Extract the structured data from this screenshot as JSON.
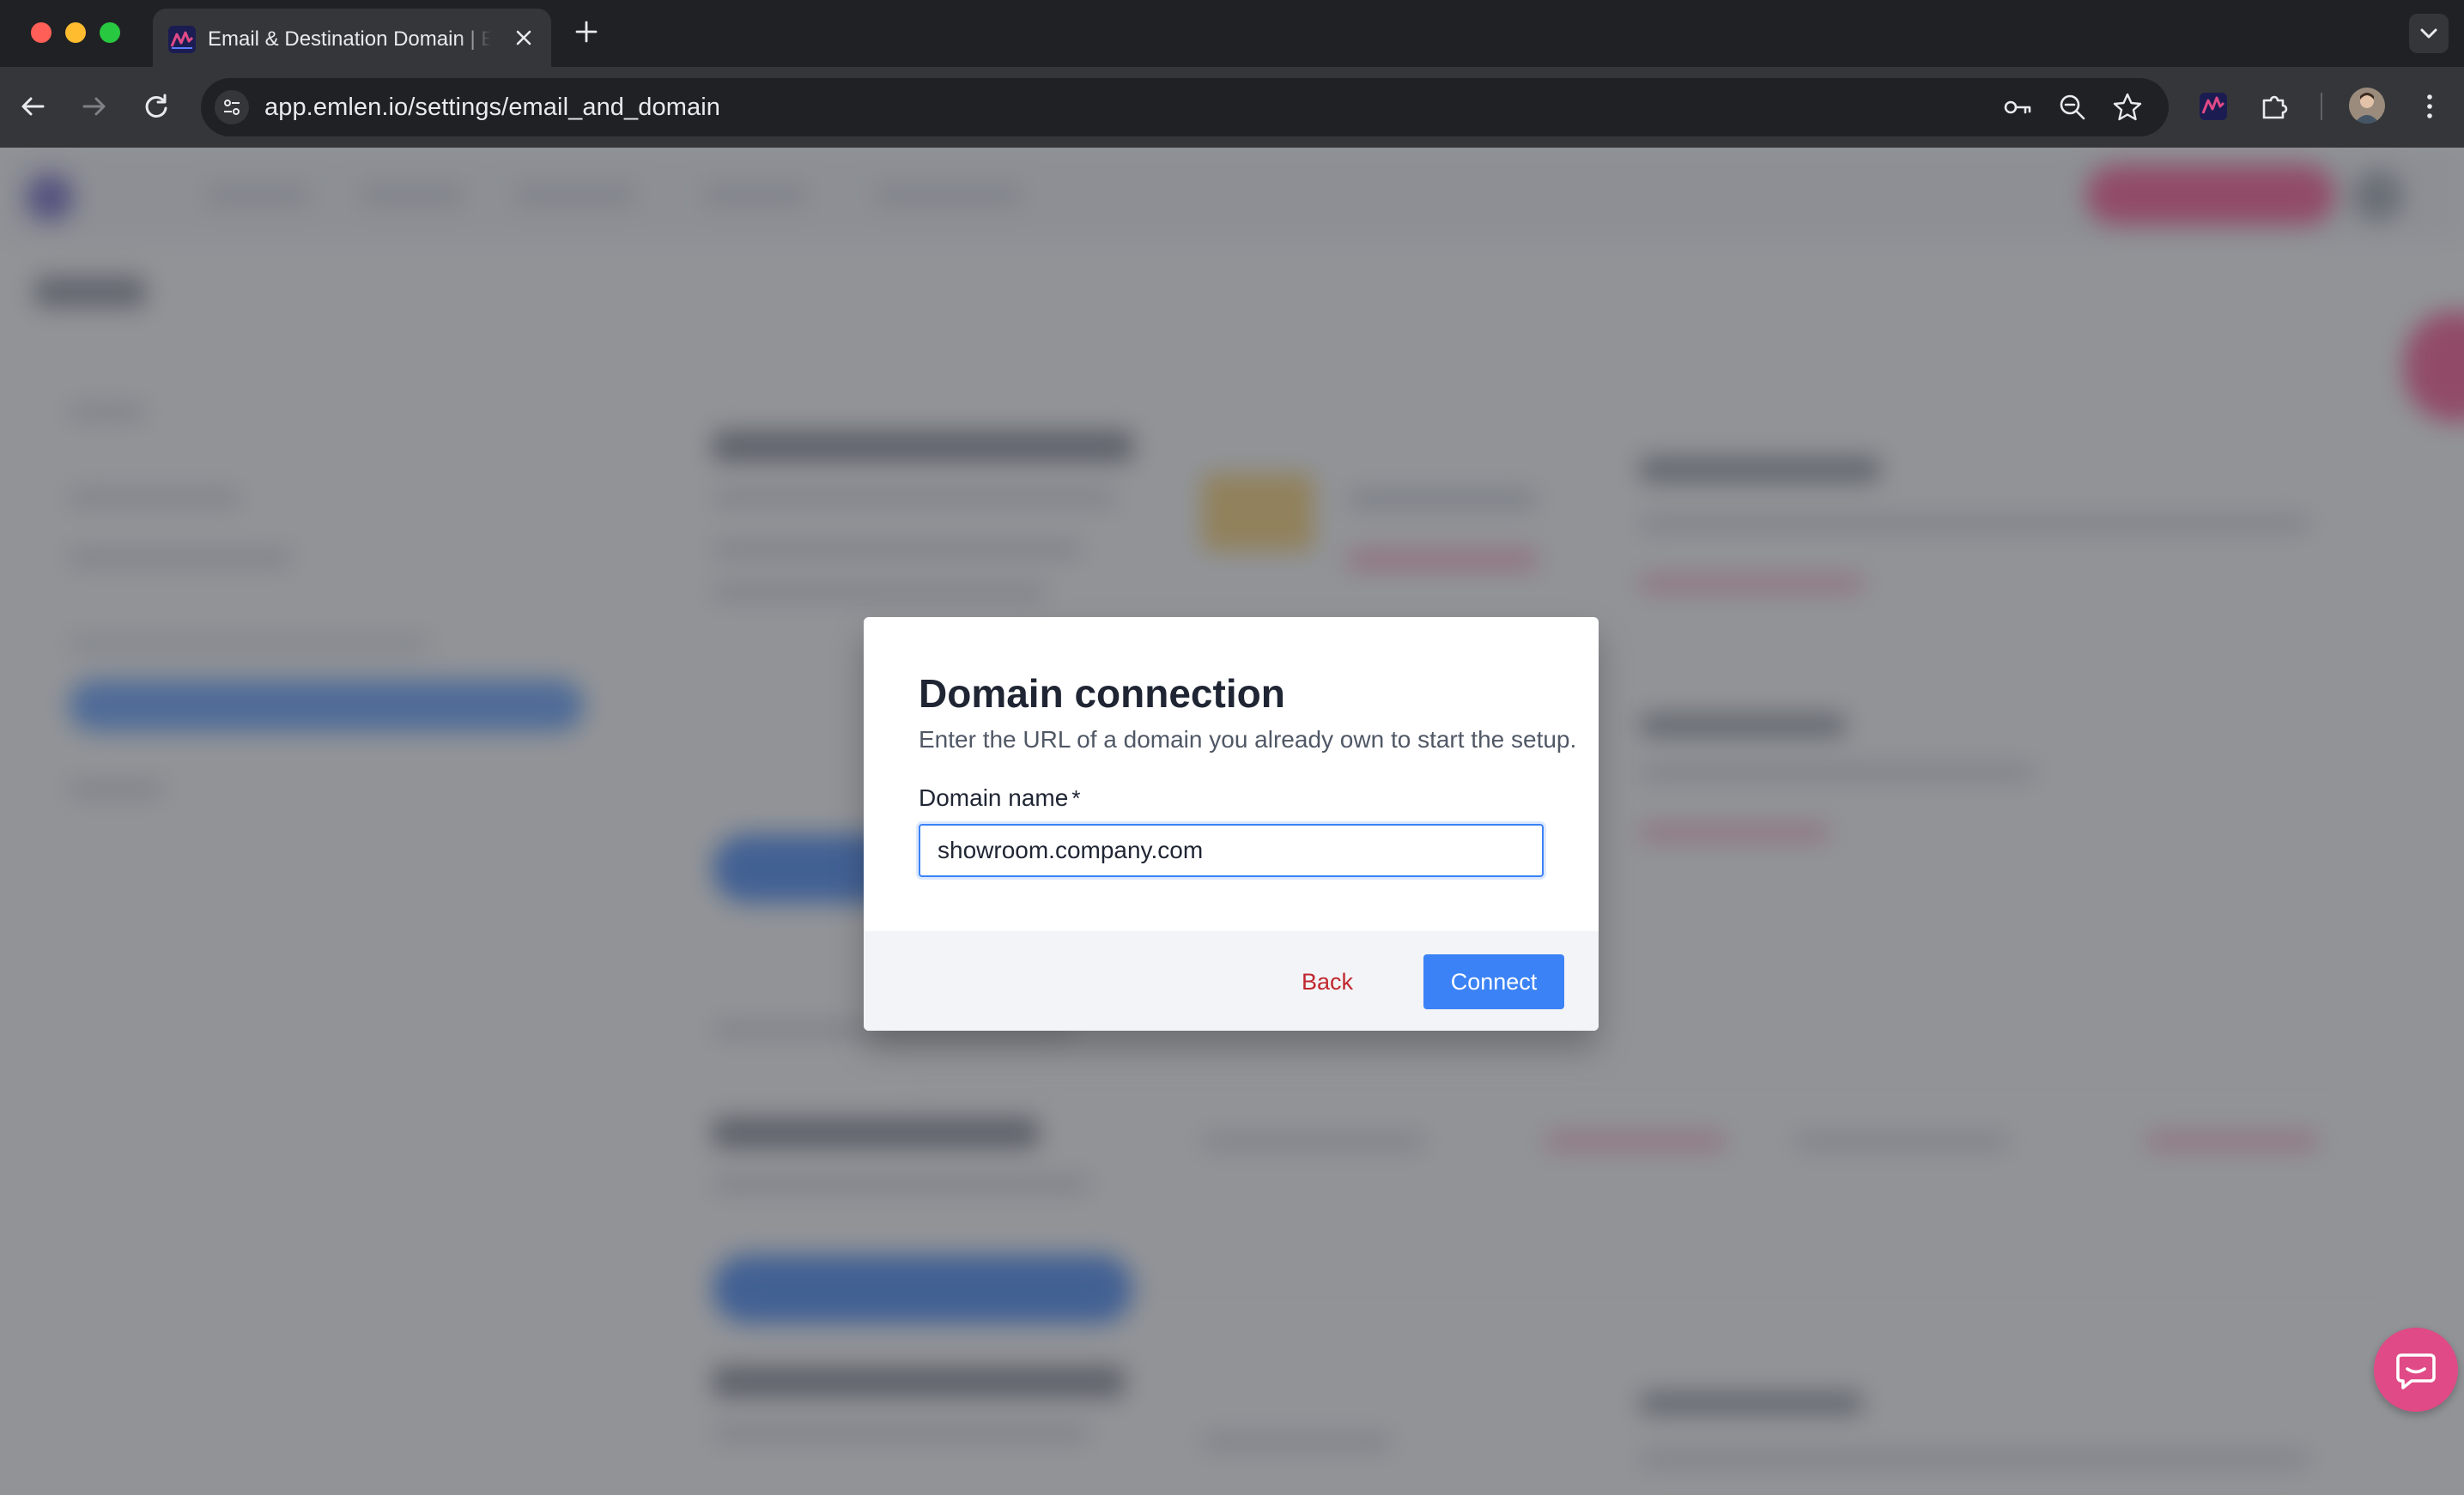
{
  "browser": {
    "tab_title": "Email & Destination Domain | Emlen",
    "url": "app.emlen.io/settings/email_and_domain",
    "colors": {
      "close": "#ff5f57",
      "minimize": "#febc2e",
      "maximize": "#28c840"
    }
  },
  "modal": {
    "title": "Domain connection",
    "description": "Enter the URL of a domain you already own to start the setup.",
    "field_label": "Domain name",
    "required_mark": "*",
    "field_value": "showroom.company.com",
    "back_label": "Back",
    "connect_label": "Connect"
  },
  "colors": {
    "primary": "#3b82f6",
    "danger": "#c0262d",
    "chat": "#e04a86"
  }
}
